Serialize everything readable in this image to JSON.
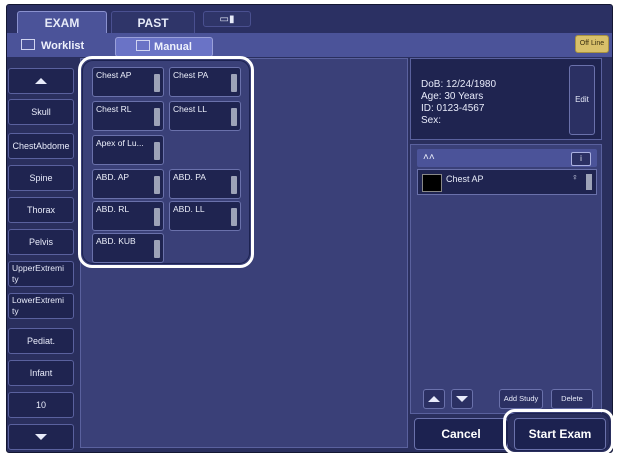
{
  "tabs": {
    "exam": "EXAM",
    "past": "PAST",
    "extra_icon": "monitor-icon"
  },
  "subtabs": {
    "worklist": "Worklist",
    "manual": "Manual"
  },
  "status": {
    "offline": "Off Line"
  },
  "categories": [
    "Skull",
    "ChestAbdome",
    "Spine",
    "Thorax",
    "Pelvis",
    "UpperExtremi\nty",
    "LowerExtremi\nty",
    "Pediat.",
    "Infant",
    "10"
  ],
  "protocols": [
    "Chest AP",
    "Chest PA",
    "Chest RL",
    "Chest LL",
    "Apex of Lu...",
    "ABD. AP",
    "ABD. PA",
    "ABD. RL",
    "ABD. LL",
    "ABD. KUB"
  ],
  "patient": {
    "dob": "DoB: 12/24/1980",
    "age": "Age: 30 Years",
    "id": "ID: 0123-4567",
    "sex": "Sex:",
    "edit": "Edit"
  },
  "study": {
    "info": "i",
    "rows": [
      {
        "label": "Chest AP",
        "swatch": "#000000"
      }
    ]
  },
  "buttons": {
    "add_study": "Add Study",
    "delete": "Delete",
    "cancel": "Cancel",
    "start_exam": "Start Exam"
  },
  "colors": {
    "background": "#2a2f5e",
    "accent": "#4b5399",
    "button": "#1f2450",
    "offline": "#d8c06a",
    "highlight": "#ffffff"
  }
}
